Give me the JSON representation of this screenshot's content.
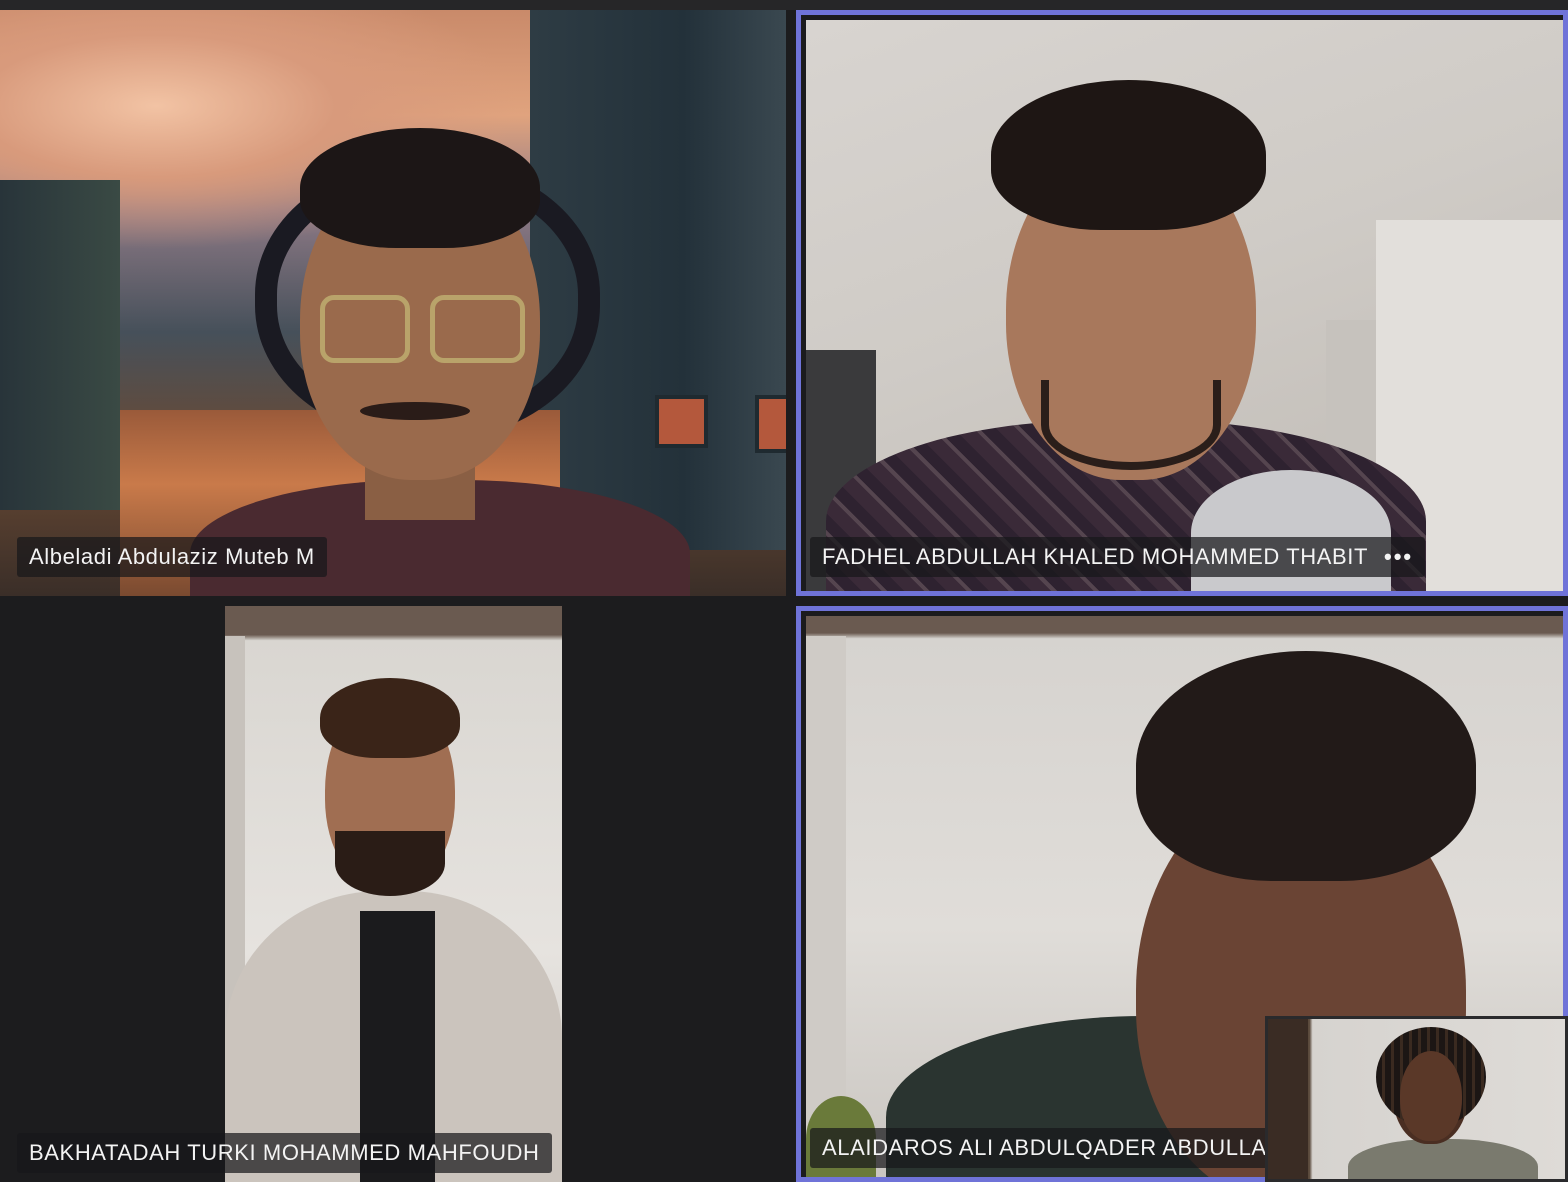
{
  "participants": [
    {
      "name": "Albeladi Abdulaziz Muteb M",
      "speaking": false
    },
    {
      "name": "FADHEL ABDULLAH KHALED MOHAMMED THABIT",
      "speaking": true,
      "more_icon": "more-dots-icon",
      "more_label": "•••"
    },
    {
      "name": "BAKHATADAH TURKI MOHAMMED MAHFOUDH",
      "speaking": false
    },
    {
      "name": "ALAIDAROS ALI ABDULQADER ABDULLAH",
      "speaking": true
    }
  ],
  "self_view": {
    "label": ""
  },
  "colors": {
    "speaking_border": "#6f73d8",
    "background": "#1c1c1e"
  }
}
